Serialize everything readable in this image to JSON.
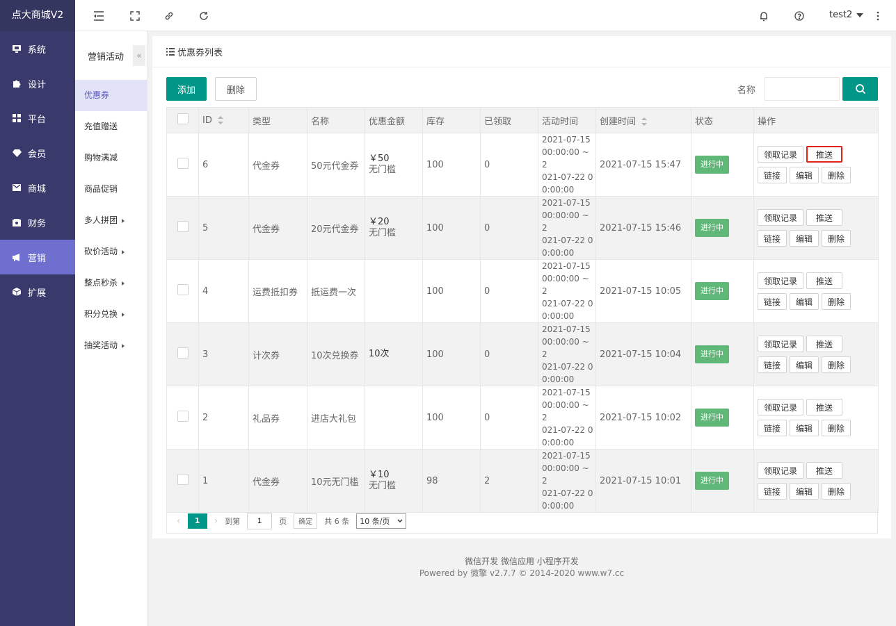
{
  "brand": "点大商城V2",
  "nav": [
    {
      "label": "系统",
      "icon": "monitor-icon"
    },
    {
      "label": "设计",
      "icon": "puzzle-icon"
    },
    {
      "label": "平台",
      "icon": "grid-icon"
    },
    {
      "label": "会员",
      "icon": "diamond-icon"
    },
    {
      "label": "商城",
      "icon": "mail-icon"
    },
    {
      "label": "财务",
      "icon": "cash-icon"
    },
    {
      "label": "营销",
      "icon": "megaphone-icon",
      "active": true
    },
    {
      "label": "扩展",
      "icon": "cube-icon"
    }
  ],
  "topbar": {
    "user": "test2"
  },
  "subnav": {
    "title": "营销活动",
    "collapse": "«",
    "items": [
      {
        "label": "优惠券",
        "active": true
      },
      {
        "label": "充值赠送"
      },
      {
        "label": "购物满减"
      },
      {
        "label": "商品促销"
      },
      {
        "label": "多人拼团",
        "arrow": true
      },
      {
        "label": "砍价活动",
        "arrow": true
      },
      {
        "label": "整点秒杀",
        "arrow": true
      },
      {
        "label": "积分兑换",
        "arrow": true
      },
      {
        "label": "抽奖活动",
        "arrow": true
      }
    ]
  },
  "panel": {
    "title": "优惠券列表",
    "add": "添加",
    "delete": "删除",
    "search_label": "名称",
    "search_value": ""
  },
  "table": {
    "headers": [
      "ID",
      "类型",
      "名称",
      "优惠金额",
      "库存",
      "已领取",
      "活动时间",
      "创建时间",
      "状态",
      "操作"
    ],
    "rows": [
      {
        "id": "6",
        "type": "代金券",
        "name": "50元代金券",
        "amount": "￥50",
        "threshold": "无门槛",
        "stock": "100",
        "claimed": "0",
        "act1": "2021-07-15",
        "act2": "00:00:00 ~ 2",
        "act3": "021-07-22 0",
        "act4": "0:00:00",
        "created": "2021-07-15 15:47",
        "status": "进行中"
      },
      {
        "id": "5",
        "type": "代金券",
        "name": "20元代金券",
        "amount": "￥20",
        "threshold": "无门槛",
        "stock": "100",
        "claimed": "0",
        "act1": "2021-07-15",
        "act2": "00:00:00 ~ 2",
        "act3": "021-07-22 0",
        "act4": "0:00:00",
        "created": "2021-07-15 15:46",
        "status": "进行中"
      },
      {
        "id": "4",
        "type": "运费抵扣券",
        "name": "抵运费一次",
        "amount": "",
        "threshold": "",
        "stock": "100",
        "claimed": "0",
        "act1": "2021-07-15",
        "act2": "00:00:00 ~ 2",
        "act3": "021-07-22 0",
        "act4": "0:00:00",
        "created": "2021-07-15 10:05",
        "status": "进行中"
      },
      {
        "id": "3",
        "type": "计次券",
        "name": "10次兑换券",
        "amount": "10次",
        "threshold": "",
        "stock": "100",
        "claimed": "0",
        "act1": "2021-07-15",
        "act2": "00:00:00 ~ 2",
        "act3": "021-07-22 0",
        "act4": "0:00:00",
        "created": "2021-07-15 10:04",
        "status": "进行中"
      },
      {
        "id": "2",
        "type": "礼品券",
        "name": "进店大礼包",
        "amount": "",
        "threshold": "",
        "stock": "100",
        "claimed": "0",
        "act1": "2021-07-15",
        "act2": "00:00:00 ~ 2",
        "act3": "021-07-22 0",
        "act4": "0:00:00",
        "created": "2021-07-15 10:02",
        "status": "进行中"
      },
      {
        "id": "1",
        "type": "代金券",
        "name": "10元无门槛",
        "amount": "￥10",
        "threshold": "无门槛",
        "stock": "98",
        "claimed": "2",
        "act1": "2021-07-15",
        "act2": "00:00:00 ~ 2",
        "act3": "021-07-22 0",
        "act4": "0:00:00",
        "created": "2021-07-15 10:01",
        "status": "进行中"
      }
    ],
    "ops": {
      "records": "领取记录",
      "push": "推送",
      "link": "链接",
      "edit": "编辑",
      "delete": "删除"
    }
  },
  "pager": {
    "current": "1",
    "goto": "到第",
    "page_input": "1",
    "page_unit": "页",
    "confirm": "确定",
    "total": "共 6 条",
    "per_page": "10 条/页"
  },
  "footer": {
    "line1": "微信开发 微信应用 小程序开发",
    "line2": "Powered by 微擎 v2.7.7 © 2014-2020 www.w7.cc"
  }
}
